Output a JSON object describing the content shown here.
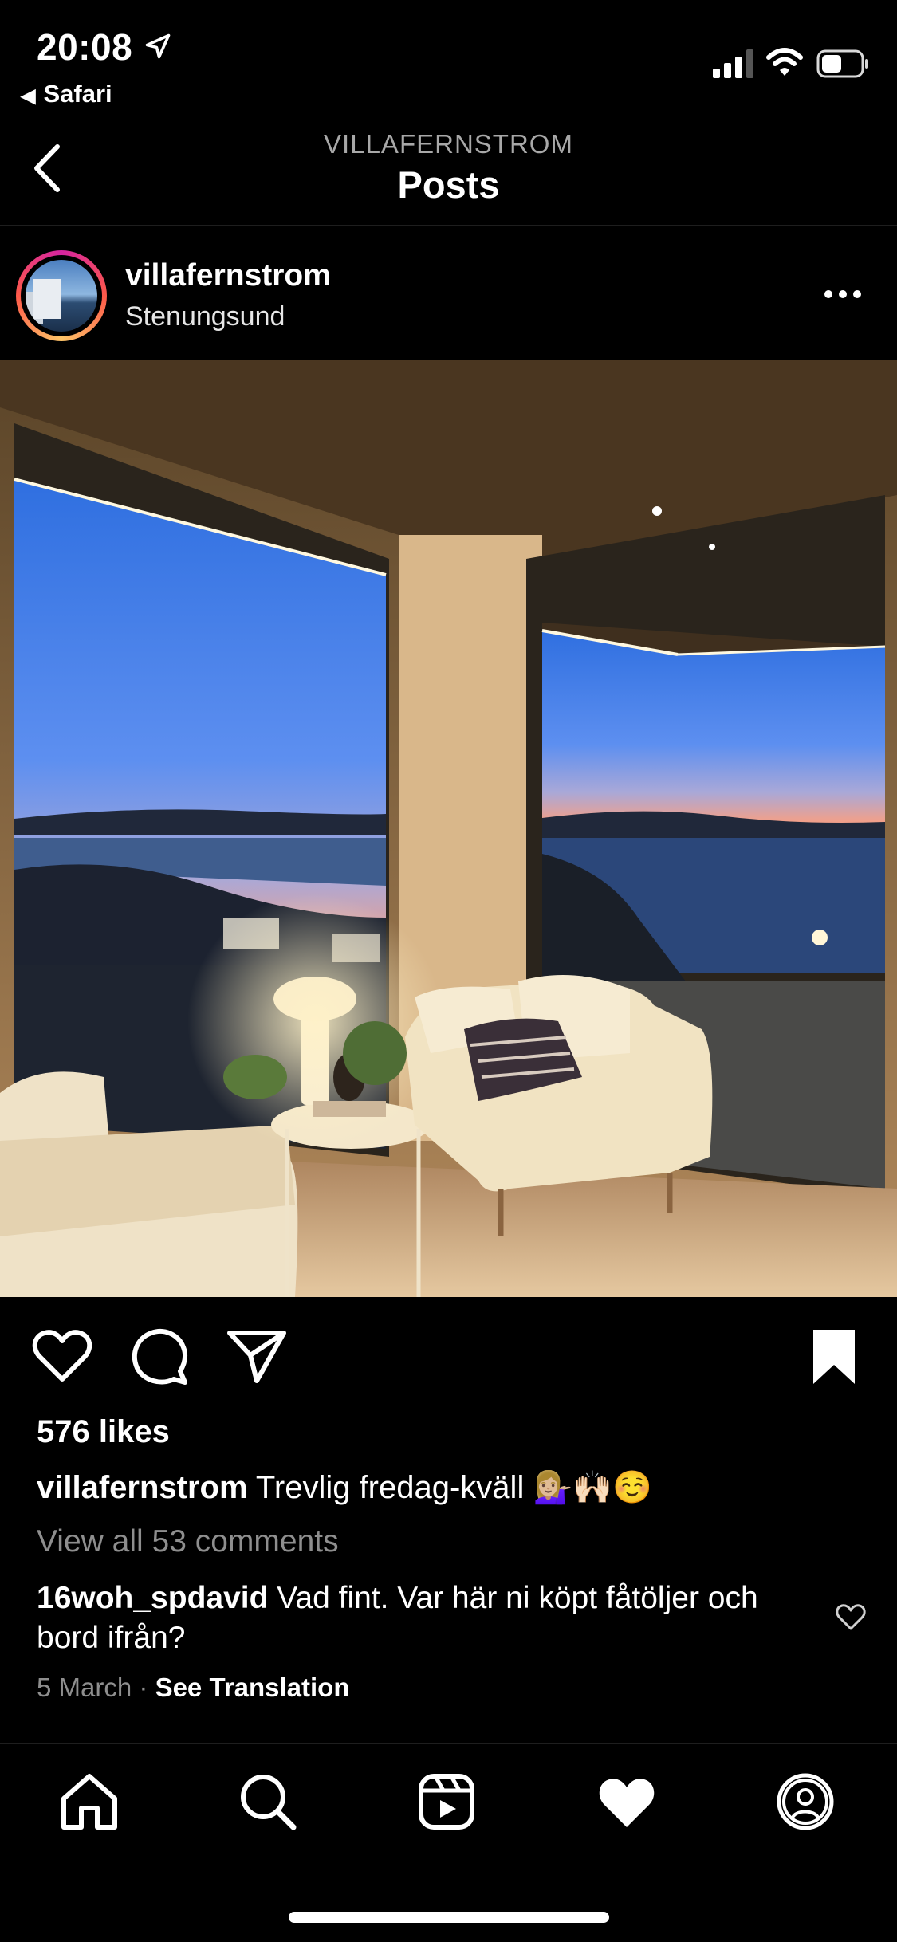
{
  "status_bar": {
    "time": "20:08",
    "back_app": "Safari",
    "back_glyph": "◀"
  },
  "nav": {
    "subtitle": "VILLAFERNSTROM",
    "title": "Posts"
  },
  "post": {
    "username": "villafernstrom",
    "location": "Stenungsund",
    "likes": "576 likes",
    "caption_user": "villafernstrom",
    "caption_text": " Trevlig fredag-kväll 💁🏼‍♀️🙌🏻☺️",
    "view_comments": "View all 53 comments",
    "comment_user": "16woh_spdavid",
    "comment_text": " Vad fint. Var här ni köpt fåtöljer och bord ifrån?",
    "date": "5 March",
    "separator": "·",
    "see_translation": "See Translation"
  },
  "icons": {
    "nav": [
      "back-chevron-icon",
      "more-options-icon"
    ],
    "actions": [
      "heart-icon",
      "comment-icon",
      "share-icon",
      "bookmark-icon"
    ],
    "tabs": [
      "home-icon",
      "search-icon",
      "reels-icon",
      "heart-filled-icon",
      "profile-icon"
    ]
  },
  "colors": {
    "background": "#000000",
    "muted_text": "#8e8e8e",
    "subtitle_text": "#a8a8a8"
  }
}
